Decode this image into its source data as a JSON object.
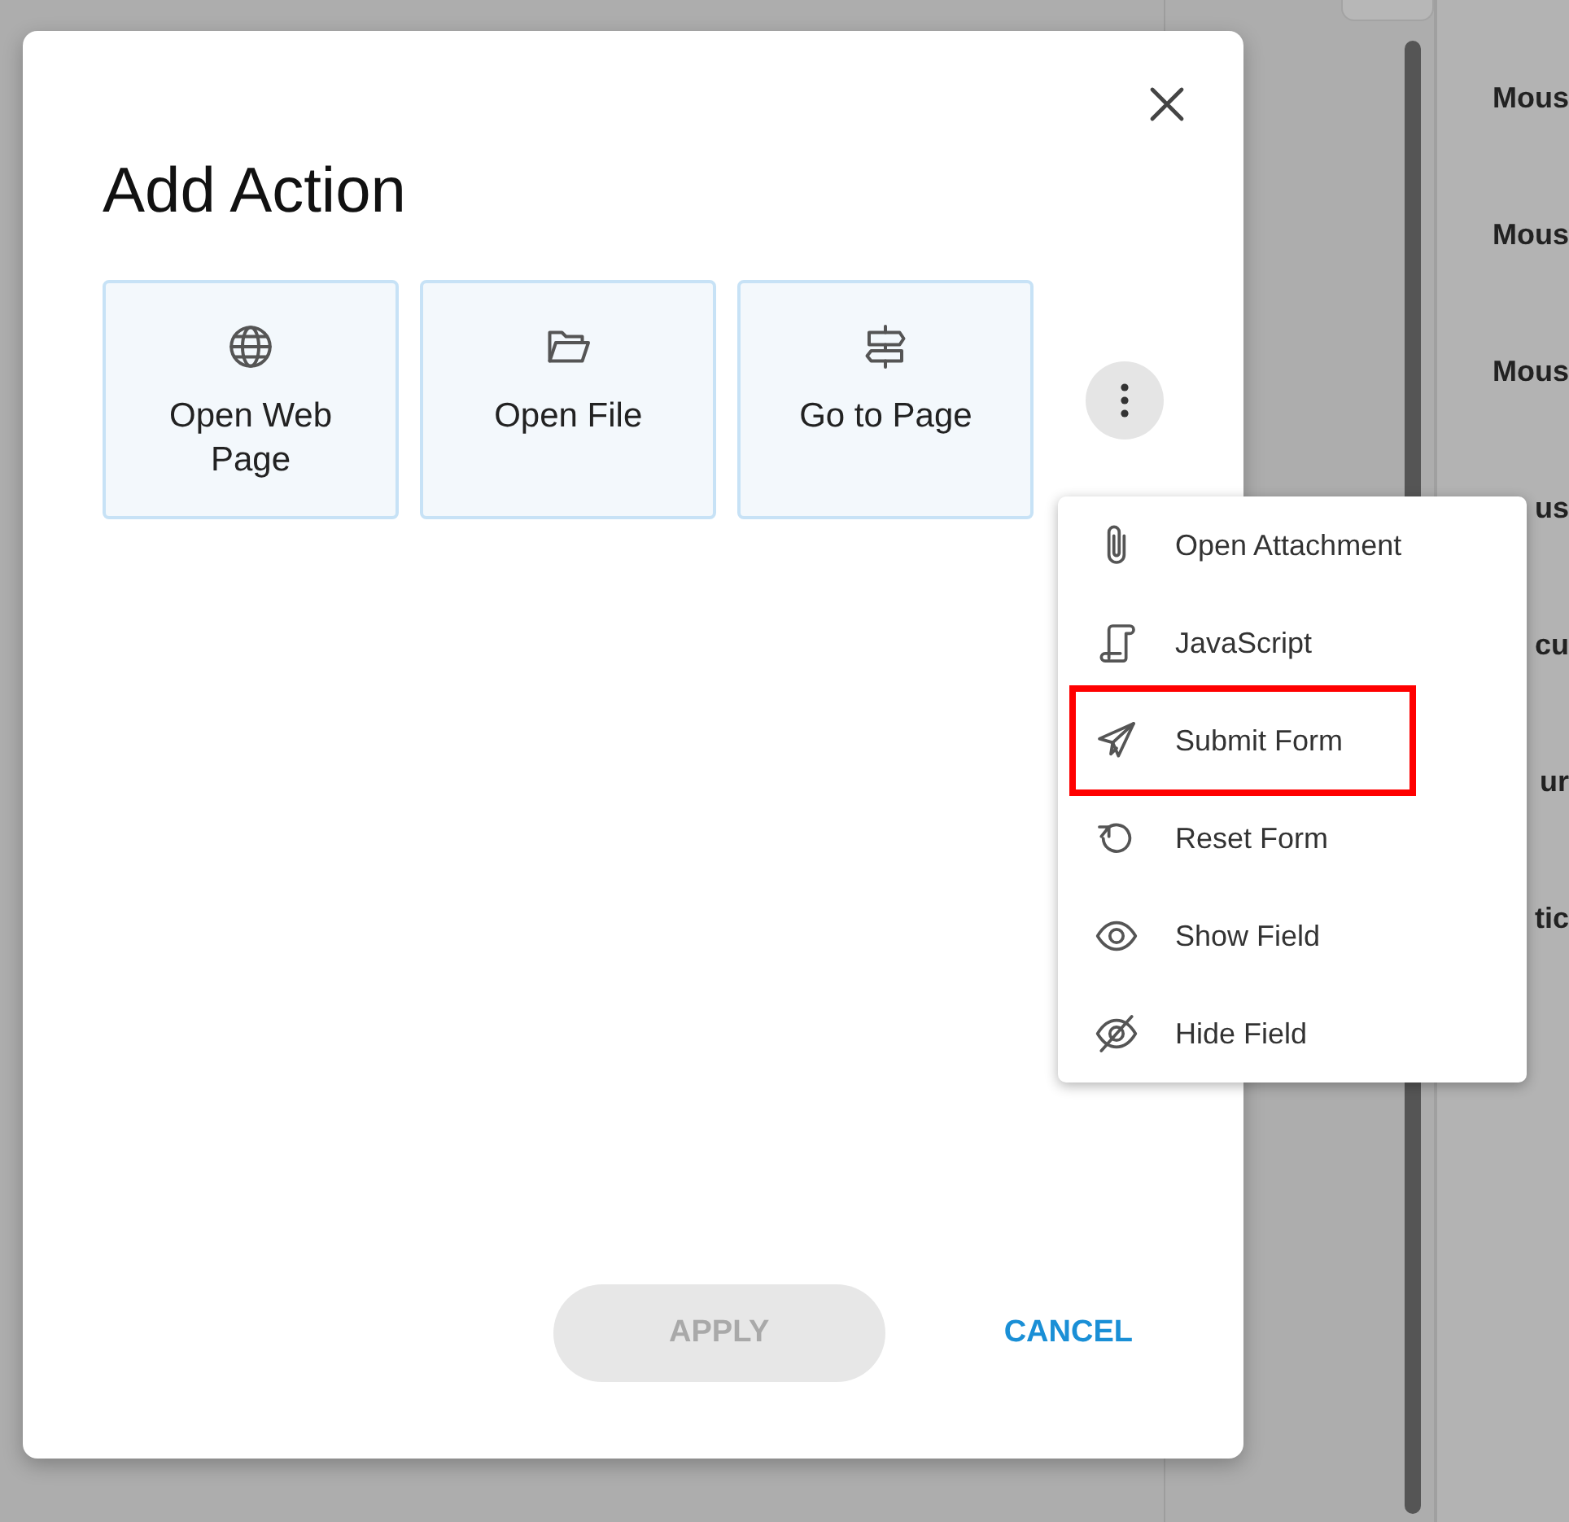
{
  "background_panel": {
    "items": [
      "Mous",
      "Mous",
      "Mous",
      "us",
      "cu",
      "ur",
      "tic"
    ]
  },
  "dialog": {
    "title": "Add Action",
    "cards": [
      {
        "label": "Open Web Page"
      },
      {
        "label": "Open File"
      },
      {
        "label": "Go to Page"
      }
    ],
    "menu": {
      "items": [
        {
          "label": "Open Attachment",
          "highlighted": false
        },
        {
          "label": "JavaScript",
          "highlighted": false
        },
        {
          "label": "Submit Form",
          "highlighted": true
        },
        {
          "label": "Reset Form",
          "highlighted": false
        },
        {
          "label": "Show Field",
          "highlighted": false
        },
        {
          "label": "Hide Field",
          "highlighted": false
        }
      ]
    },
    "buttons": [
      {
        "label": "APPLY",
        "kind": "filled",
        "disabled": true
      },
      {
        "label": "CANCEL",
        "kind": "text",
        "disabled": false
      }
    ]
  }
}
